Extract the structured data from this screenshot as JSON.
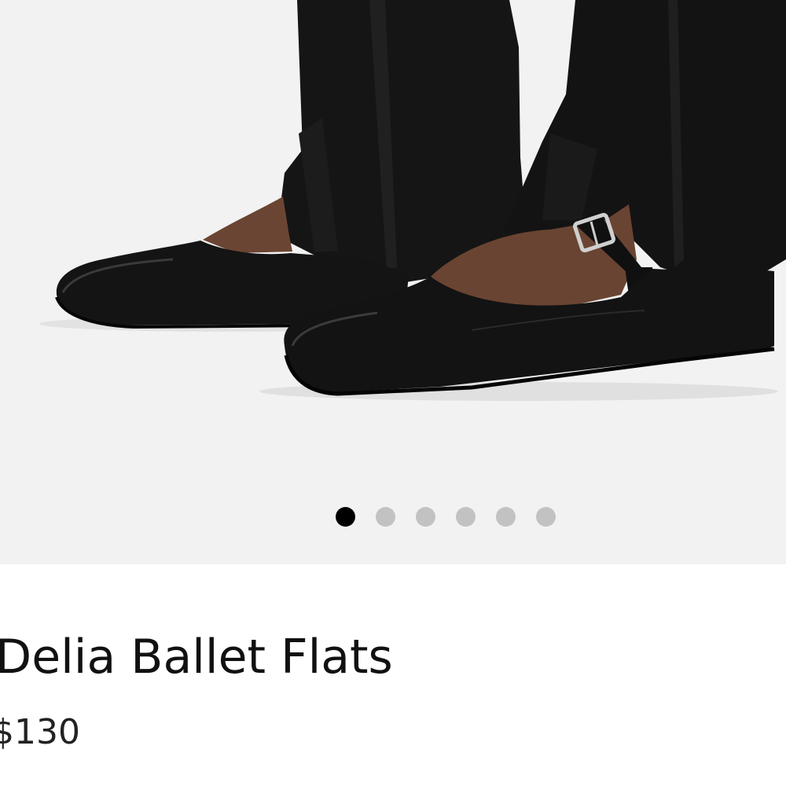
{
  "gallery": {
    "image_alt": "model wearing black square-toe Mary Jane ballet flats with buckle strap and black trousers",
    "slide_count": 6,
    "active_slide": 1,
    "background_color": "#f2f2f2",
    "dot_active_color": "#000000",
    "dot_inactive_color": "#c2c2c2"
  },
  "product": {
    "title": "Delia Ballet Flats",
    "price": "$130"
  }
}
